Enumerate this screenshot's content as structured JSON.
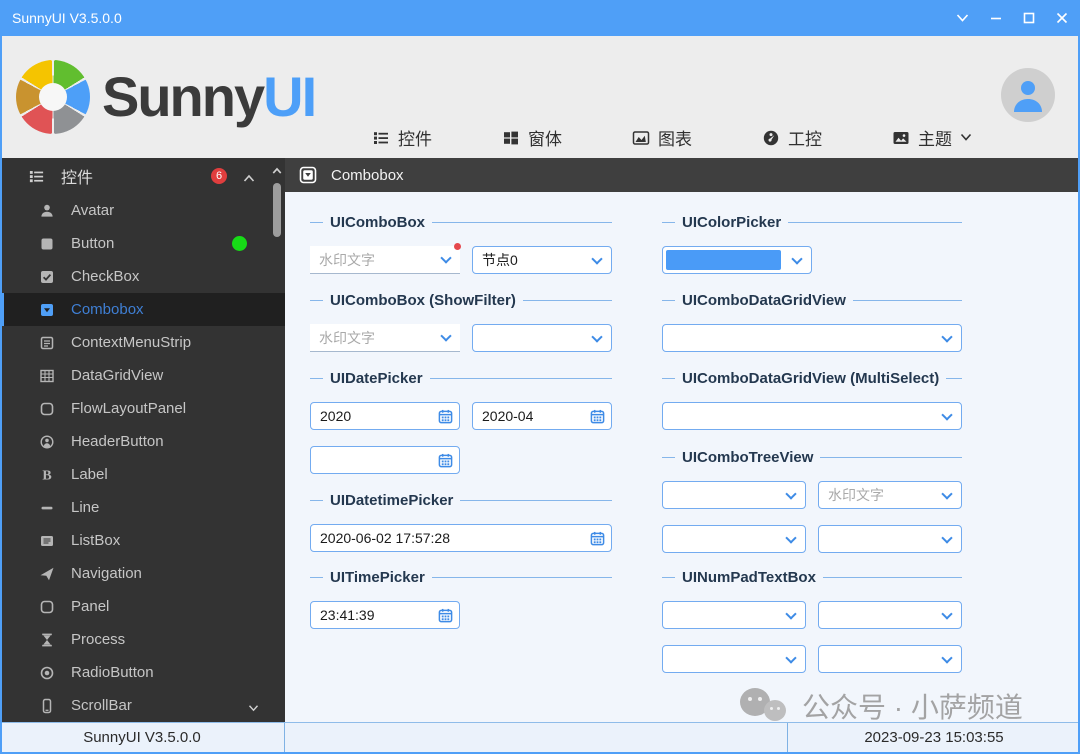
{
  "titlebar": {
    "title": "SunnyUI V3.5.0.0"
  },
  "header": {
    "logo_primary": "Sunny",
    "logo_secondary": "UI",
    "nav": [
      {
        "label": "控件"
      },
      {
        "label": "窗体"
      },
      {
        "label": "图表"
      },
      {
        "label": "工控"
      },
      {
        "label": "主题"
      }
    ]
  },
  "sidebar": {
    "header_label": "控件",
    "badge": "6",
    "items": [
      {
        "label": "Avatar"
      },
      {
        "label": "Button"
      },
      {
        "label": "CheckBox"
      },
      {
        "label": "Combobox",
        "selected": true
      },
      {
        "label": "ContextMenuStrip"
      },
      {
        "label": "DataGridView"
      },
      {
        "label": "FlowLayoutPanel"
      },
      {
        "label": "HeaderButton"
      },
      {
        "label": "Label"
      },
      {
        "label": "Line"
      },
      {
        "label": "ListBox"
      },
      {
        "label": "Navigation"
      },
      {
        "label": "Panel"
      },
      {
        "label": "Process"
      },
      {
        "label": "RadioButton"
      },
      {
        "label": "ScrollBar"
      }
    ]
  },
  "content": {
    "page_title": "Combobox",
    "left": {
      "combobox": {
        "title": "UIComboBox",
        "combo1_placeholder": "水印文字",
        "combo2_value": "节点0"
      },
      "showfilter": {
        "title": "UIComboBox (ShowFilter)",
        "combo1_placeholder": "水印文字"
      },
      "datepicker": {
        "title": "UIDatePicker",
        "value1": "2020",
        "value2": "2020-04"
      },
      "datetimepicker": {
        "title": "UIDatetimePicker",
        "value": "2020-06-02 17:57:28"
      },
      "timepicker": {
        "title": "UITimePicker",
        "value": "23:41:39"
      }
    },
    "right": {
      "colorpicker": {
        "title": "UIColorPicker",
        "swatch_color": "#4A9BF7"
      },
      "combodatagrid": {
        "title": "UIComboDataGridView"
      },
      "combodatagrid_multi": {
        "title": "UIComboDataGridView (MultiSelect)"
      },
      "combotree": {
        "title": "UIComboTreeView",
        "combo2_placeholder": "水印文字"
      },
      "numpad": {
        "title": "UINumPadTextBox"
      }
    }
  },
  "statusbar": {
    "left": "SunnyUI V3.5.0.0",
    "right": "2023-09-23 15:03:55"
  },
  "watermark": {
    "text": "公众号 · 小萨频道"
  },
  "colors": {
    "primary": "#4F9FF7",
    "badge_red": "#E03E3E",
    "status_green": "#17DB17",
    "combo_border": "#73ABF0",
    "sidebar_bg": "#333333",
    "content_bg": "#F2F6FC"
  }
}
